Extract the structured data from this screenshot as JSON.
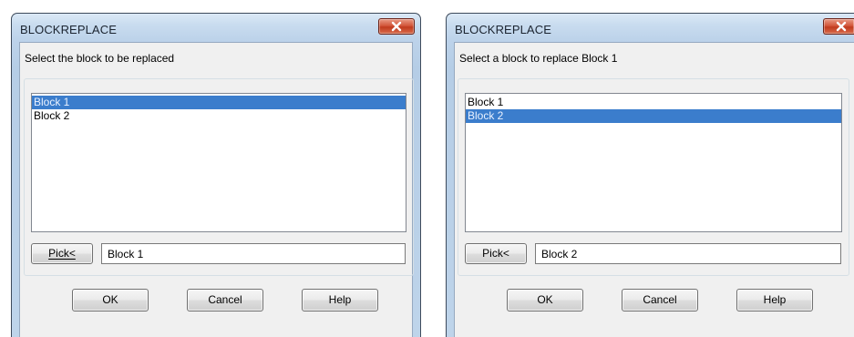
{
  "dialogs": [
    {
      "title": "BLOCKREPLACE",
      "prompt": "Select the block to be replaced",
      "list_items": [
        {
          "label": "Block 1",
          "selected": true
        },
        {
          "label": "Block 2",
          "selected": false
        }
      ],
      "pick_label": "Pick<",
      "pick_value": "Block 1",
      "ok_label": "OK",
      "cancel_label": "Cancel",
      "help_label": "Help"
    },
    {
      "title": "BLOCKREPLACE",
      "prompt": "Select a block to replace Block 1",
      "list_items": [
        {
          "label": "Block 1",
          "selected": false
        },
        {
          "label": "Block 2",
          "selected": true
        }
      ],
      "pick_label": "Pick<",
      "pick_value": "Block 2",
      "ok_label": "OK",
      "cancel_label": "Cancel",
      "help_label": "Help"
    }
  ],
  "icons": {
    "close": "close-icon"
  },
  "colors": {
    "selection": "#3b7dcc",
    "close_button": "#c84a2e",
    "title_bar": "#c9dcef",
    "client_background": "#f0f0f0"
  }
}
